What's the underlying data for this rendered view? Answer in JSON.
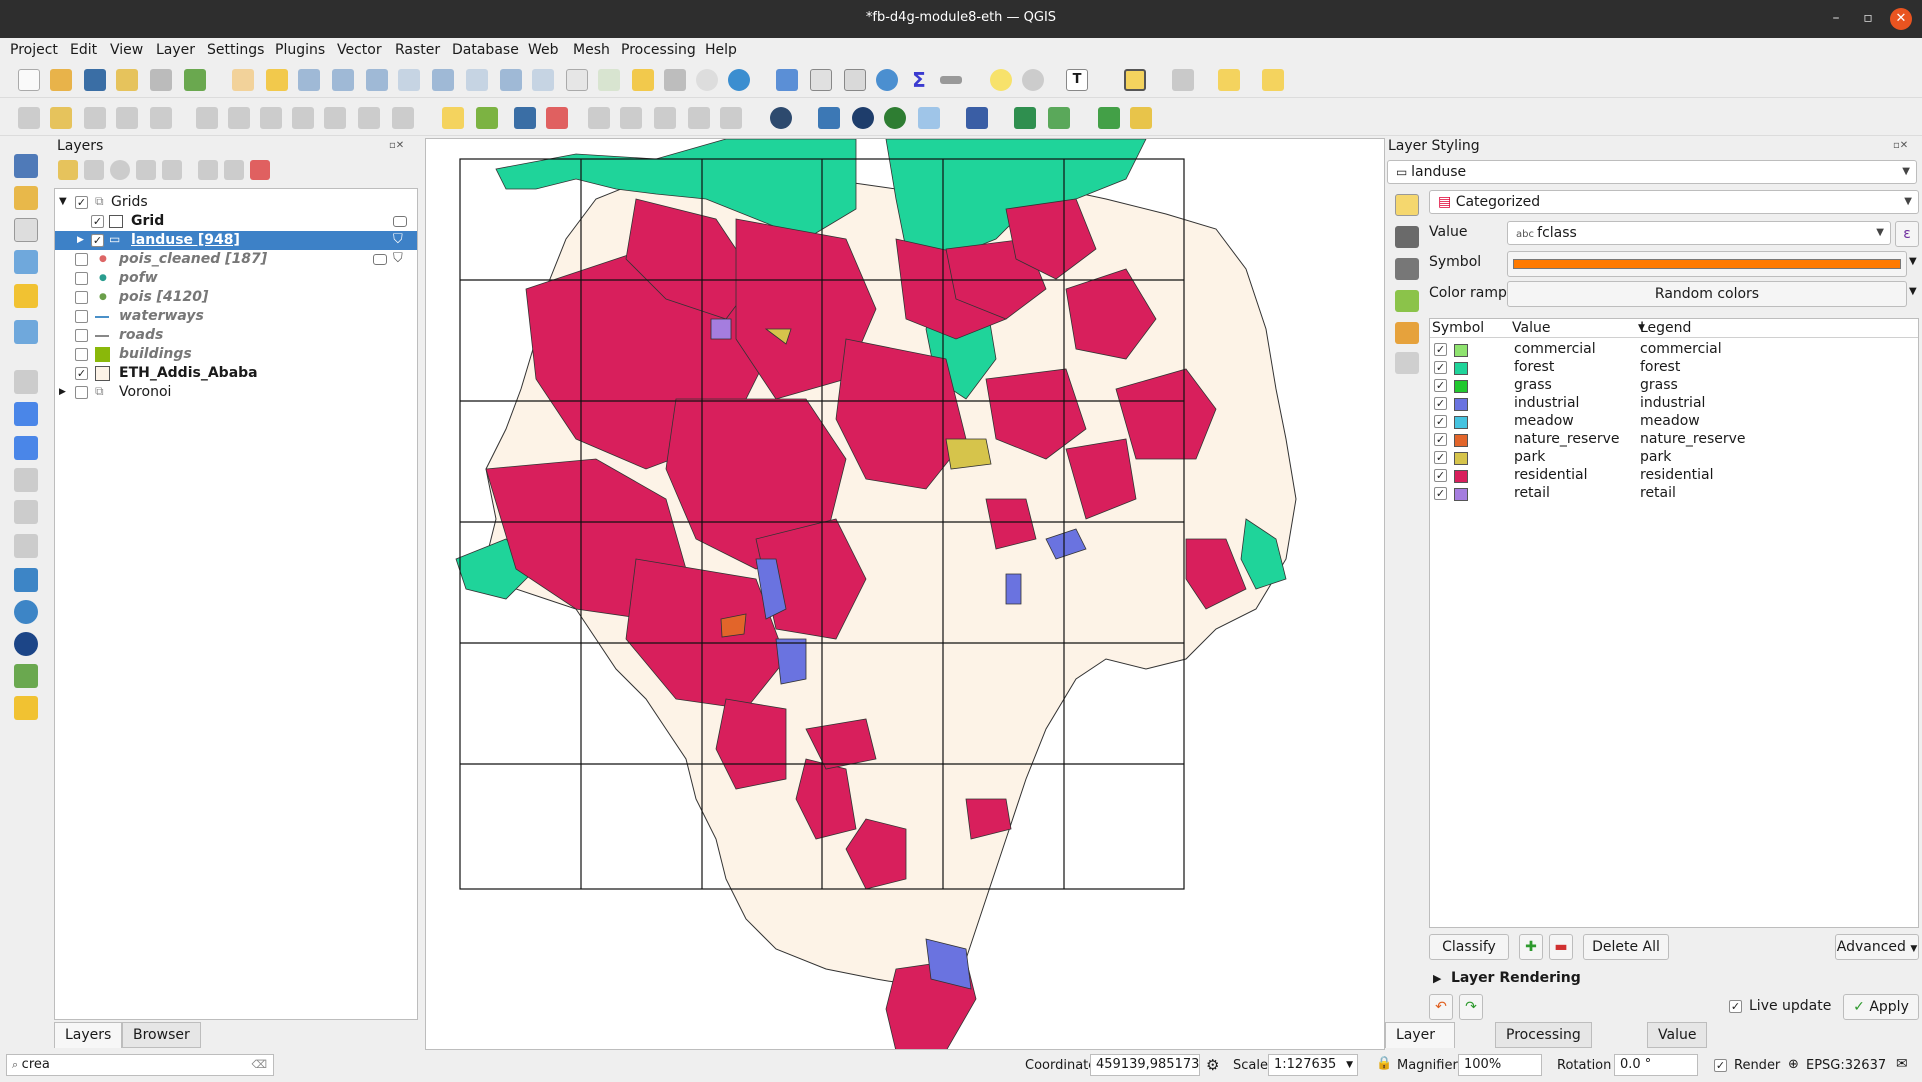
{
  "window": {
    "title": "*fb-d4g-module8-eth — QGIS"
  },
  "menu": [
    "Project",
    "Edit",
    "View",
    "Layer",
    "Settings",
    "Plugins",
    "Vector",
    "Raster",
    "Database",
    "Web",
    "Mesh",
    "Processing",
    "Help"
  ],
  "layers_panel": {
    "title": "Layers",
    "items": [
      {
        "label": "Grids",
        "checked": true
      },
      {
        "label": "Grid",
        "checked": true
      },
      {
        "label": "landuse [948]",
        "checked": true
      },
      {
        "label": "pois_cleaned [187]",
        "checked": false
      },
      {
        "label": "pofw",
        "checked": false
      },
      {
        "label": "pois [4120]",
        "checked": false
      },
      {
        "label": "waterways",
        "checked": false
      },
      {
        "label": "roads",
        "checked": false
      },
      {
        "label": "buildings",
        "checked": false
      },
      {
        "label": "ETH_Addis_Ababa",
        "checked": true
      },
      {
        "label": "Voronoi",
        "checked": false
      }
    ],
    "tabs": [
      "Layers",
      "Browser"
    ]
  },
  "style_panel": {
    "title": "Layer Styling",
    "layer": "landuse",
    "renderer": "Categorized",
    "value_label": "Value",
    "value_field": "fclass",
    "symbol_label": "Symbol",
    "symbol_color": "#ff7a00",
    "ramp_label": "Color ramp",
    "ramp_value": "Random colors",
    "columns": [
      "Symbol",
      "Value",
      "Legend"
    ],
    "categories": [
      {
        "value": "commercial",
        "legend": "commercial",
        "color": "#8fe36f"
      },
      {
        "value": "forest",
        "legend": "forest",
        "color": "#1fd49a"
      },
      {
        "value": "grass",
        "legend": "grass",
        "color": "#21c82e"
      },
      {
        "value": "industrial",
        "legend": "industrial",
        "color": "#6a73e0"
      },
      {
        "value": "meadow",
        "legend": "meadow",
        "color": "#45c3e0"
      },
      {
        "value": "nature_reserve",
        "legend": "nature_reserve",
        "color": "#e2652a"
      },
      {
        "value": "park",
        "legend": "park",
        "color": "#d6c44b"
      },
      {
        "value": "residential",
        "legend": "residential",
        "color": "#d81f5c"
      },
      {
        "value": "retail",
        "legend": "retail",
        "color": "#a57ddf"
      }
    ],
    "classify": "Classify",
    "delete_all": "Delete All",
    "advanced": "Advanced",
    "layer_rendering": "Layer Rendering",
    "live_update": "Live update",
    "apply": "Apply",
    "tabs": [
      "Layer Styling",
      "Processing Toolbox",
      "Value Tool"
    ]
  },
  "statusbar": {
    "search": "crea",
    "coordinate_label": "Coordinate",
    "coordinate": "459139,985173",
    "scale_label": "Scale",
    "scale": "1:127635",
    "magnifier_label": "Magnifier",
    "magnifier": "100%",
    "rotation_label": "Rotation",
    "rotation": "0.0 °",
    "render_label": "Render",
    "crs": "EPSG:32637"
  }
}
